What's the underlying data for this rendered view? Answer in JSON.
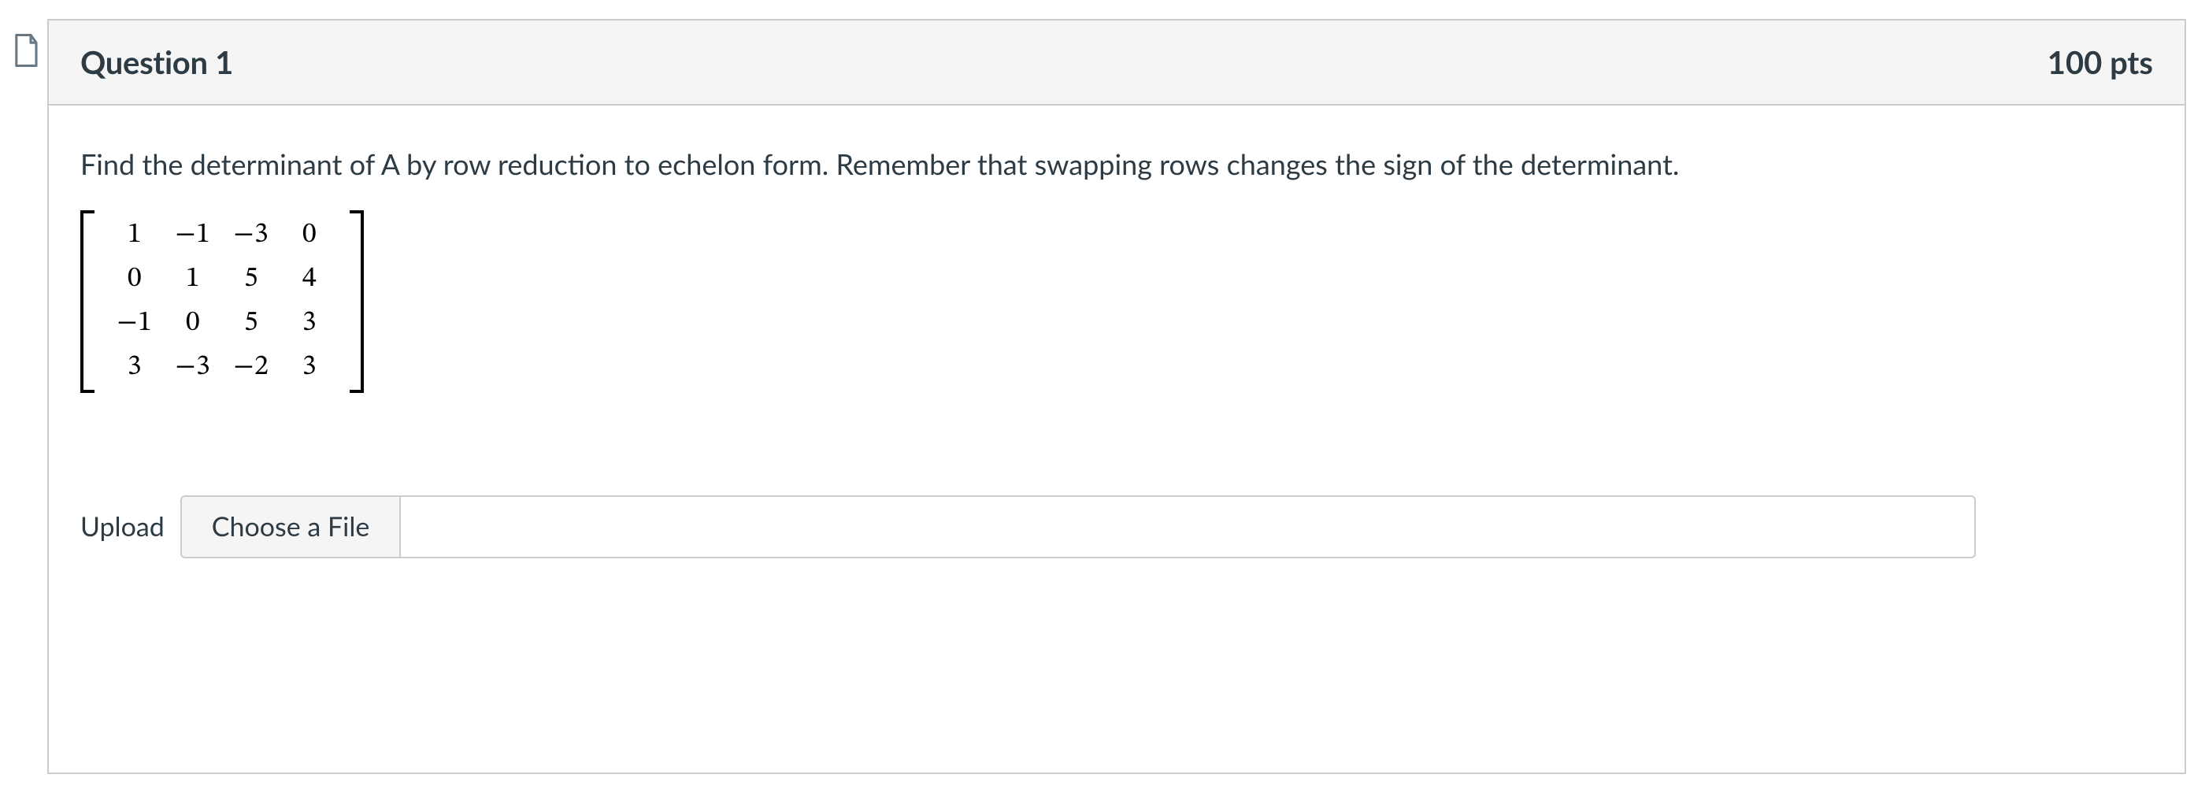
{
  "question": {
    "title": "Question 1",
    "points_text": "100 pts",
    "prompt": "Find the determinant of A by row reduction to echelon form.  Remember that swapping rows changes the sign of the determinant.",
    "matrix": {
      "rows": 4,
      "cols": 4,
      "cells": [
        [
          "1",
          "−1",
          "−3",
          "0"
        ],
        [
          "0",
          "1",
          "5",
          "4"
        ],
        [
          "−1",
          "0",
          "5",
          "3"
        ],
        [
          "3",
          "−3",
          "−2",
          "3"
        ]
      ]
    }
  },
  "upload": {
    "label": "Upload",
    "choose_label": "Choose a File",
    "filename": ""
  }
}
